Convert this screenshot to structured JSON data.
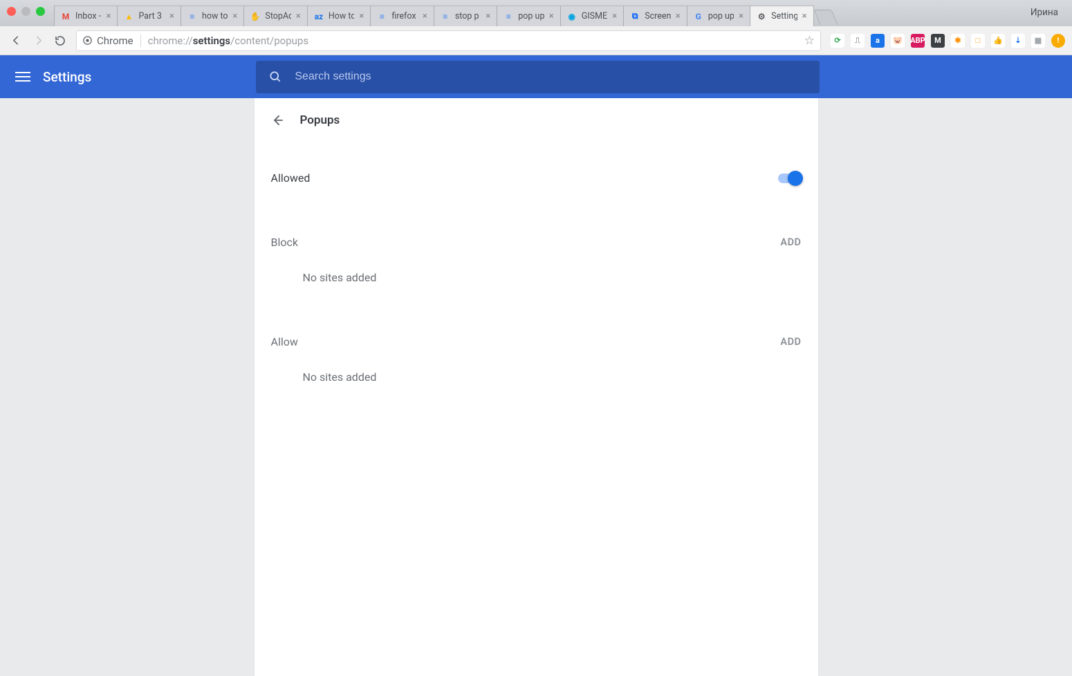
{
  "window": {
    "profile_name": "Ирина"
  },
  "tabs": [
    {
      "label": "Inbox -",
      "favicon": "M",
      "favicon_color": "#ea4335"
    },
    {
      "label": "Part 3",
      "favicon": "▲",
      "favicon_color": "#fbbc04"
    },
    {
      "label": "how to",
      "favicon": "≡",
      "favicon_color": "#4285f4"
    },
    {
      "label": "StopAd",
      "favicon": "✋",
      "favicon_color": "#e8502f"
    },
    {
      "label": "How to",
      "favicon": "az",
      "favicon_color": "#1a73e8"
    },
    {
      "label": "firefox",
      "favicon": "≡",
      "favicon_color": "#4285f4"
    },
    {
      "label": "stop p",
      "favicon": "≡",
      "favicon_color": "#4285f4"
    },
    {
      "label": "pop up",
      "favicon": "≡",
      "favicon_color": "#4285f4"
    },
    {
      "label": "GISME",
      "favicon": "◉",
      "favicon_color": "#00a3e0"
    },
    {
      "label": "Screen",
      "favicon": "⧉",
      "favicon_color": "#0061ff"
    },
    {
      "label": "pop up",
      "favicon": "G",
      "favicon_color": "#4285f4"
    },
    {
      "label": "Setting",
      "favicon": "⚙",
      "favicon_color": "#5f6368",
      "active": true
    }
  ],
  "omnibox": {
    "chip_label": "Chrome",
    "url_prefix": "chrome://",
    "url_bold": "settings",
    "url_suffix": "/content/popups"
  },
  "extensions": [
    {
      "glyph": "⟳",
      "color": "#34a853",
      "bg": "#fff"
    },
    {
      "glyph": "⎍",
      "color": "#9aa0a6",
      "bg": "#fff"
    },
    {
      "glyph": "a",
      "color": "#fff",
      "bg": "#1a73e8"
    },
    {
      "glyph": "🐷",
      "color": "#f48fb1",
      "bg": "#fff"
    },
    {
      "glyph": "ABP",
      "color": "#fff",
      "bg": "#d81b60"
    },
    {
      "glyph": "M",
      "color": "#fff",
      "bg": "#3c4043"
    },
    {
      "glyph": "✱",
      "color": "#ff8f00",
      "bg": "#fff"
    },
    {
      "glyph": "□",
      "color": "#ff8f00",
      "bg": "#fff"
    },
    {
      "glyph": "👍",
      "color": "#9aa0a6",
      "bg": "#fff"
    },
    {
      "glyph": "⇣",
      "color": "#1a73e8",
      "bg": "#fff"
    },
    {
      "glyph": "▦",
      "color": "#9aa0a6",
      "bg": "#fff"
    },
    {
      "glyph": "!",
      "color": "#fff",
      "bg": "#f9ab00"
    }
  ],
  "header": {
    "title": "Settings",
    "search_placeholder": "Search settings"
  },
  "page": {
    "title": "Popups",
    "allowed_label": "Allowed",
    "allowed_on": true,
    "block_label": "Block",
    "block_add": "ADD",
    "block_empty": "No sites added",
    "allow_label": "Allow",
    "allow_add": "ADD",
    "allow_empty": "No sites added"
  }
}
